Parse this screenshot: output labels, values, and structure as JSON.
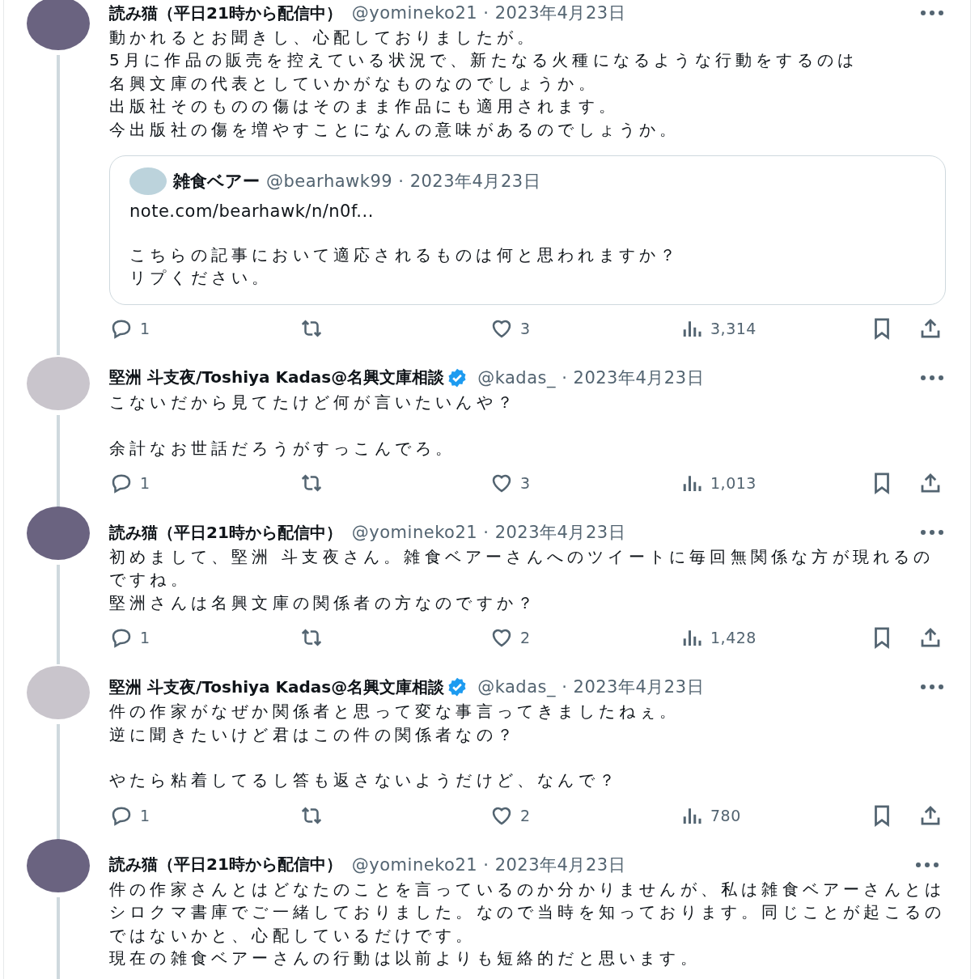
{
  "tweets": [
    {
      "author": "読み猫（平日21時から配信中）",
      "verified": false,
      "meta": "@yomineko21 · 2023年4月23日",
      "paragraphs": [
        [
          "動かれるとお聞きし、心配しておりましたが。",
          "5月に作品の販売を控えている状況で、新たなる火種になるような行動をするのは",
          "名興文庫の代表としていかがなものなのでしょうか。",
          "出版社そのものの傷はそのまま作品にも適用されます。",
          "今出版社の傷を増やすことになんの意味があるのでしょうか。"
        ]
      ],
      "quote": {
        "author": "雑食ベアー",
        "meta": "@bearhawk99 · 2023年4月23日",
        "link": "note.com/bearhawk/n/n0f...",
        "lines": [
          "こちらの記事において適応されるものは何と思われますか？",
          "リプください。"
        ]
      },
      "actions": [
        {
          "kind": "reply",
          "count": "1"
        },
        {
          "kind": "retweet"
        },
        {
          "kind": "like",
          "count": "3"
        },
        {
          "kind": "views",
          "count": "3,314"
        },
        {
          "kind": "bookmark"
        },
        {
          "kind": "share"
        }
      ]
    },
    {
      "author": "堅洲 斗支夜/Toshiya Kadas@名興文庫相談",
      "verified": true,
      "meta": "@kadas_ · 2023年4月23日",
      "paragraphs": [
        [
          "こないだから見てたけど何が言いたいんや？"
        ],
        [
          "余計なお世話だろうがすっこんでろ。"
        ]
      ],
      "actions": [
        {
          "kind": "reply",
          "count": "1"
        },
        {
          "kind": "retweet"
        },
        {
          "kind": "like",
          "count": "3"
        },
        {
          "kind": "views",
          "count": "1,013"
        },
        {
          "kind": "bookmark"
        },
        {
          "kind": "share"
        }
      ]
    },
    {
      "author": "読み猫（平日21時から配信中）",
      "verified": false,
      "meta": "@yomineko21 · 2023年4月23日",
      "paragraphs": [
        [
          "初めまして、堅洲 斗支夜さん。雑食ベアーさんへのツイートに毎回無関係な方が現れるのですね。",
          "堅洲さんは名興文庫の関係者の方なのですか？"
        ]
      ],
      "actions": [
        {
          "kind": "reply",
          "count": "1"
        },
        {
          "kind": "retweet"
        },
        {
          "kind": "like",
          "count": "2"
        },
        {
          "kind": "views",
          "count": "1,428"
        },
        {
          "kind": "bookmark"
        },
        {
          "kind": "share"
        }
      ]
    },
    {
      "author": "堅洲 斗支夜/Toshiya Kadas@名興文庫相談",
      "verified": true,
      "meta": "@kadas_ · 2023年4月23日",
      "paragraphs": [
        [
          "件の作家がなぜか関係者と思って変な事言ってきましたねぇ。",
          "逆に聞きたいけど君はこの件の関係者なの？"
        ],
        [
          "やたら粘着してるし答も返さないようだけど、なんで？"
        ]
      ],
      "actions": [
        {
          "kind": "reply",
          "count": "1"
        },
        {
          "kind": "retweet"
        },
        {
          "kind": "like",
          "count": "2"
        },
        {
          "kind": "views",
          "count": "780"
        },
        {
          "kind": "bookmark"
        },
        {
          "kind": "share"
        }
      ]
    },
    {
      "author": "読み猫（平日21時から配信中）",
      "verified": false,
      "meta": "@yomineko21 · 2023年4月23日",
      "paragraphs": [
        [
          "件の作家さんとはどなたのことを言っているのか分かりませんが、私は雑食ベアーさんとはシロクマ書庫でご一緒しておりました。なので当時を知っております。同じことが起こるのではないかと、心配しているだけです。",
          "現在の雑食ベアーさんの行動は以前よりも短絡的だと思います。"
        ]
      ]
    }
  ]
}
